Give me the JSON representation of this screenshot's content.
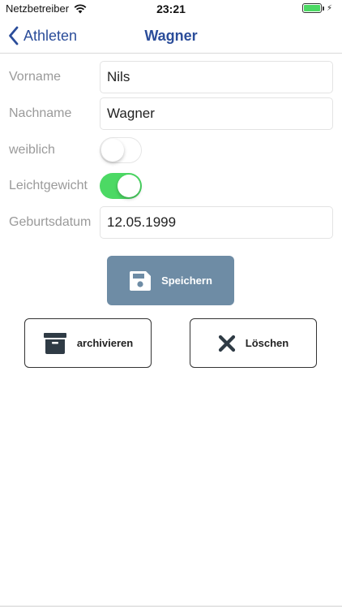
{
  "status_bar": {
    "carrier": "Netzbetreiber",
    "time": "23:21",
    "battery_level": 1.0,
    "charging_icon": "bolt-icon"
  },
  "nav": {
    "back_label": "Athleten",
    "title": "Wagner"
  },
  "form": {
    "first_name": {
      "label": "Vorname",
      "value": "Nils"
    },
    "last_name": {
      "label": "Nachname",
      "value": "Wagner"
    },
    "female": {
      "label": "weiblich",
      "on": false
    },
    "lightweight": {
      "label": "Leichtgewicht",
      "on": true
    },
    "birthdate": {
      "label": "Geburtsdatum",
      "value": "12.05.1999"
    }
  },
  "actions": {
    "save": {
      "label": "Speichern",
      "icon": "floppy-disk-icon"
    },
    "archive": {
      "label": "archivieren",
      "icon": "archive-box-icon"
    },
    "delete": {
      "label": "Löschen",
      "icon": "close-x-icon"
    }
  },
  "colors": {
    "accent": "#2b4d9a",
    "save_button": "#6e8ca5",
    "toggle_on": "#4cd964",
    "icon_dark": "#2f3b45"
  }
}
